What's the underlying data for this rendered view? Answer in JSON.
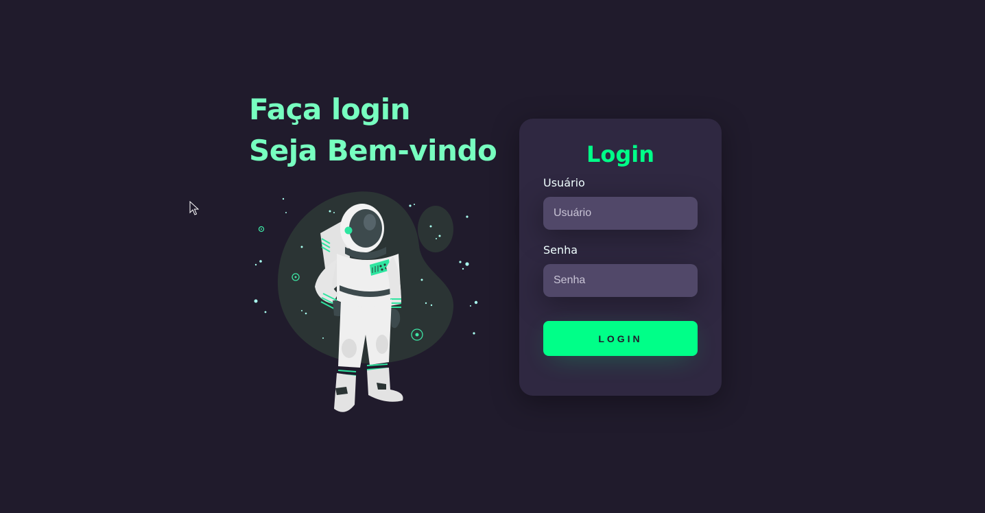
{
  "left": {
    "line1": "Faça login",
    "line2": "Seja Bem-vindo",
    "illustration": "astronaut-illustration"
  },
  "card": {
    "title": "Login",
    "username": {
      "label": "Usuário",
      "placeholder": "Usuário"
    },
    "password": {
      "label": "Senha",
      "placeholder": "Senha"
    },
    "submit_label": "Login"
  },
  "colors": {
    "background": "#201b2c",
    "headline": "#77ffc0",
    "card": "#2f2841",
    "accent": "#00ff88",
    "input": "#514869"
  }
}
